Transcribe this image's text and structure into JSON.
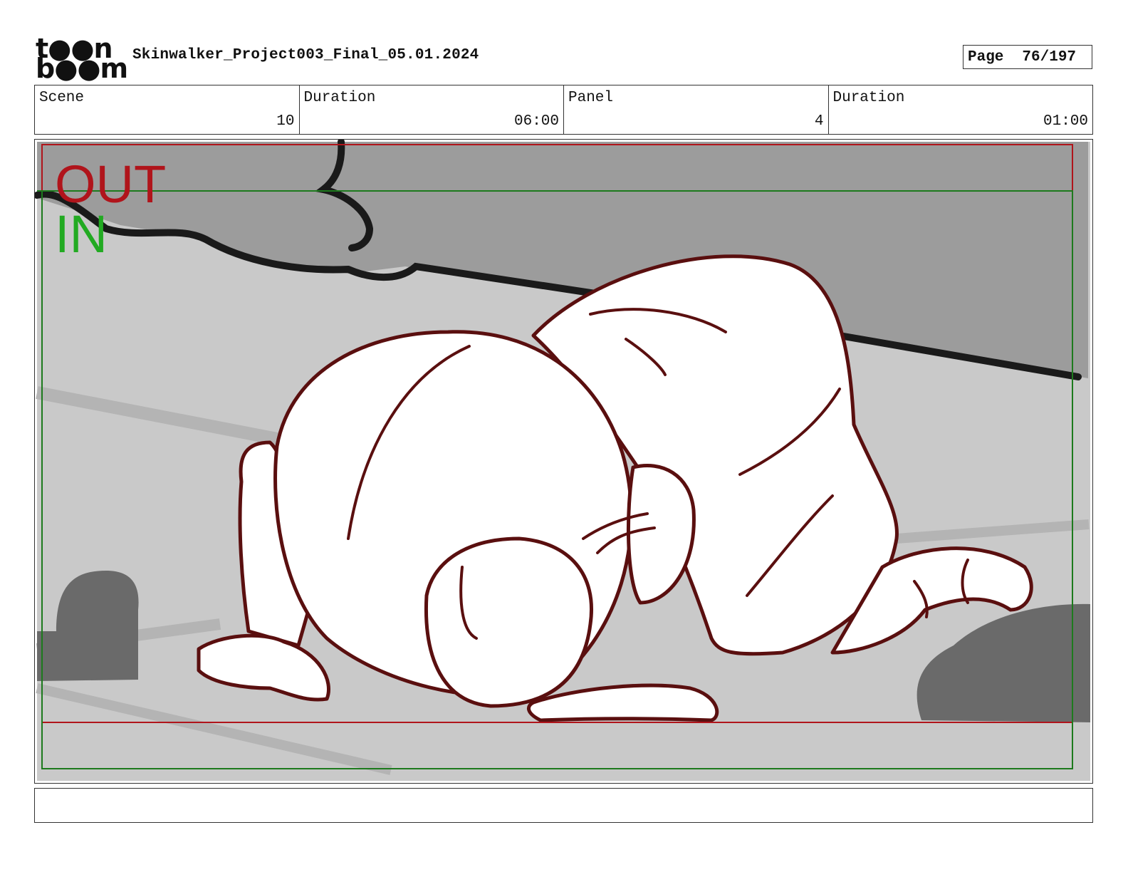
{
  "header": {
    "logo_text": "toon boom",
    "doc_title": "Skinwalker_Project003_Final_05.01.2024",
    "page_label": "Page",
    "page_value": "76/197"
  },
  "info": {
    "scene_label": "Scene",
    "scene_value": "10",
    "scene_duration_label": "Duration",
    "scene_duration_value": "06:00",
    "panel_label": "Panel",
    "panel_value": "4",
    "panel_duration_label": "Duration",
    "panel_duration_value": "01:00"
  },
  "panel": {
    "out_label": "OUT",
    "in_label": "IN",
    "colors": {
      "out_frame": "#b0141b",
      "in_frame": "#1d7a1d",
      "in_text": "#22aa22",
      "sketch_line": "#5a0f0f",
      "wall": "#9c9c9c",
      "floor": "#c9c9c9",
      "rocks": "#6a6a6a"
    }
  },
  "caption": {
    "text": ""
  }
}
